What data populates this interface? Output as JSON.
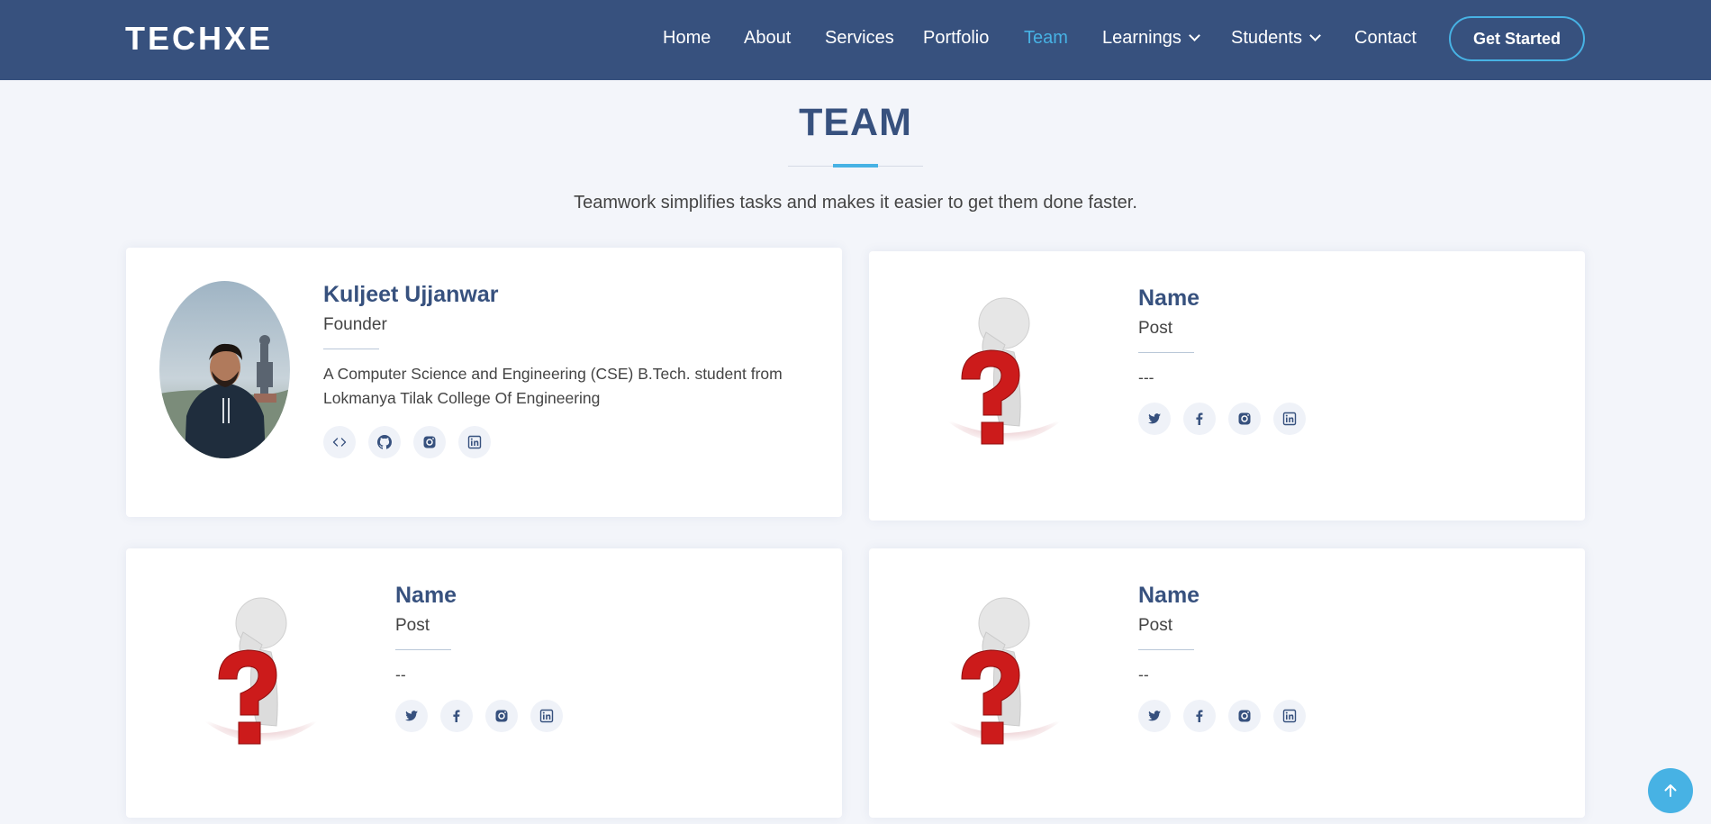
{
  "header": {
    "logo": "TECHXE",
    "nav": [
      {
        "label": "Home"
      },
      {
        "label": "About"
      },
      {
        "label": "Services"
      },
      {
        "label": "Portfolio"
      },
      {
        "label": "Team"
      },
      {
        "label": "Learnings"
      },
      {
        "label": "Students"
      },
      {
        "label": "Contact"
      }
    ],
    "active_nav": "Team",
    "cta": "Get Started"
  },
  "section": {
    "title": "TEAM",
    "subtitle": "Teamwork simplifies tasks and makes it easier to get them done faster."
  },
  "members": [
    {
      "name": "Kuljeet Ujjanwar",
      "post": "Founder",
      "desc": "A Computer Science and Engineering (CSE) B.Tech. student from Lokmanya Tilak College Of Engineering",
      "socials": [
        "code-icon",
        "github-icon",
        "instagram-icon",
        "linkedin-icon"
      ]
    },
    {
      "name": "Name",
      "post": "Post",
      "desc": "---",
      "socials": [
        "twitter-icon",
        "facebook-icon",
        "instagram-icon",
        "linkedin-icon"
      ]
    },
    {
      "name": "Name",
      "post": "Post",
      "desc": "--",
      "socials": [
        "twitter-icon",
        "facebook-icon",
        "instagram-icon",
        "linkedin-icon"
      ]
    },
    {
      "name": "Name",
      "post": "Post",
      "desc": "--",
      "socials": [
        "twitter-icon",
        "facebook-icon",
        "instagram-icon",
        "linkedin-icon"
      ]
    }
  ],
  "colors": {
    "header_bg": "#37517e",
    "accent": "#47b2e4",
    "page_bg": "#f3f5fa"
  }
}
